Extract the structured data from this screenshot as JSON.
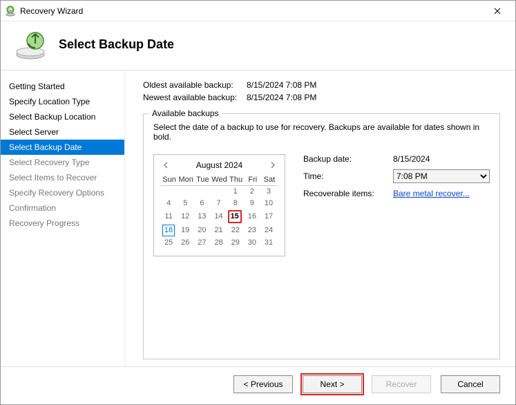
{
  "window": {
    "title": "Recovery Wizard"
  },
  "header": {
    "title": "Select Backup Date"
  },
  "sidebar": {
    "steps": [
      {
        "label": "Getting Started",
        "state": "done"
      },
      {
        "label": "Specify Location Type",
        "state": "done"
      },
      {
        "label": "Select Backup Location",
        "state": "done"
      },
      {
        "label": "Select Server",
        "state": "done"
      },
      {
        "label": "Select Backup Date",
        "state": "active"
      },
      {
        "label": "Select Recovery Type",
        "state": "pending"
      },
      {
        "label": "Select Items to Recover",
        "state": "pending"
      },
      {
        "label": "Specify Recovery Options",
        "state": "pending"
      },
      {
        "label": "Confirmation",
        "state": "pending"
      },
      {
        "label": "Recovery Progress",
        "state": "pending"
      }
    ]
  },
  "meta": {
    "oldest_label": "Oldest available backup:",
    "oldest_value": "8/15/2024 7:08 PM",
    "newest_label": "Newest available backup:",
    "newest_value": "8/15/2024 7:08 PM"
  },
  "fieldset": {
    "legend": "Available backups",
    "hint": "Select the date of a backup to use for recovery. Backups are available for dates shown in bold."
  },
  "calendar": {
    "month_label": "August 2024",
    "dow": [
      "Sun",
      "Mon",
      "Tue",
      "Wed",
      "Thu",
      "Fri",
      "Sat"
    ],
    "weeks": [
      [
        {
          "n": ""
        },
        {
          "n": ""
        },
        {
          "n": ""
        },
        {
          "n": ""
        },
        {
          "n": "1"
        },
        {
          "n": "2"
        },
        {
          "n": "3"
        }
      ],
      [
        {
          "n": "4"
        },
        {
          "n": "5"
        },
        {
          "n": "6"
        },
        {
          "n": "7"
        },
        {
          "n": "8"
        },
        {
          "n": "9"
        },
        {
          "n": "10"
        }
      ],
      [
        {
          "n": "11"
        },
        {
          "n": "12"
        },
        {
          "n": "13"
        },
        {
          "n": "14"
        },
        {
          "n": "15",
          "selected": true,
          "bold": true
        },
        {
          "n": "16"
        },
        {
          "n": "17"
        }
      ],
      [
        {
          "n": "18",
          "today": true
        },
        {
          "n": "19"
        },
        {
          "n": "20"
        },
        {
          "n": "21"
        },
        {
          "n": "22"
        },
        {
          "n": "23"
        },
        {
          "n": "24"
        }
      ],
      [
        {
          "n": "25"
        },
        {
          "n": "26"
        },
        {
          "n": "27"
        },
        {
          "n": "28"
        },
        {
          "n": "29"
        },
        {
          "n": "30"
        },
        {
          "n": "31"
        }
      ]
    ]
  },
  "details": {
    "date_label": "Backup date:",
    "date_value": "8/15/2024",
    "time_label": "Time:",
    "time_value": "7:08 PM",
    "recoverable_label": "Recoverable items:",
    "recoverable_link": "Bare metal recover..."
  },
  "footer": {
    "previous": "< Previous",
    "next": "Next >",
    "recover": "Recover",
    "cancel": "Cancel"
  }
}
